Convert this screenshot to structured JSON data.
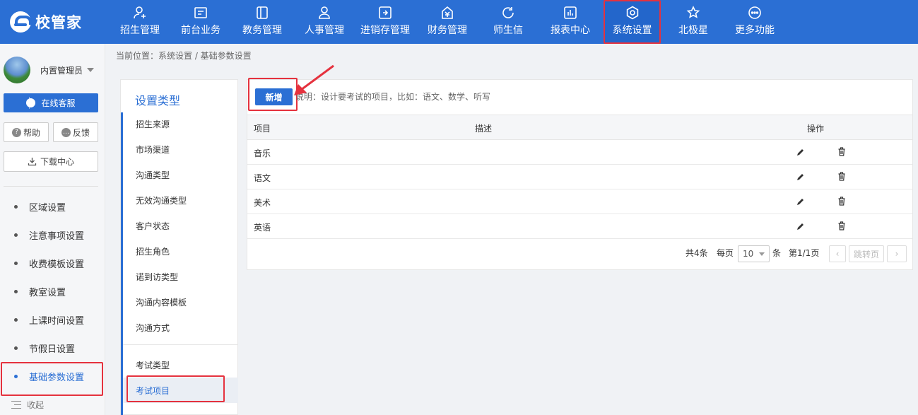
{
  "app": {
    "logo_text": "校管家"
  },
  "nav": {
    "items": [
      {
        "label": "招生管理",
        "icon": "user-add-icon"
      },
      {
        "label": "前台业务",
        "icon": "desk-icon"
      },
      {
        "label": "教务管理",
        "icon": "book-icon"
      },
      {
        "label": "人事管理",
        "icon": "person-icon"
      },
      {
        "label": "进销存管理",
        "icon": "inventory-icon"
      },
      {
        "label": "财务管理",
        "icon": "finance-icon"
      },
      {
        "label": "师生信",
        "icon": "message-icon"
      },
      {
        "label": "报表中心",
        "icon": "chart-icon"
      },
      {
        "label": "系统设置",
        "icon": "gear-icon",
        "active": true
      },
      {
        "label": "北极星",
        "icon": "star-icon"
      },
      {
        "label": "更多功能",
        "icon": "more-icon"
      }
    ]
  },
  "sidebar": {
    "username": "内置管理员",
    "service_label": "在线客服",
    "help_label": "帮助",
    "feedback_label": "反馈",
    "download_label": "下载中心",
    "menu": [
      {
        "label": "区域设置"
      },
      {
        "label": "注意事项设置"
      },
      {
        "label": "收费模板设置"
      },
      {
        "label": "教室设置"
      },
      {
        "label": "上课时间设置"
      },
      {
        "label": "节假日设置"
      },
      {
        "label": "基础参数设置",
        "active": true
      }
    ],
    "collapse_label": "收起"
  },
  "breadcrumb": "当前位置：系统设置 / 基础参数设置",
  "type_panel": {
    "title": "设置类型",
    "items": [
      "招生来源",
      "市场渠道",
      "沟通类型",
      "无效沟通类型",
      "客户状态",
      "招生角色",
      "诺到访类型",
      "沟通内容模板",
      "沟通方式"
    ],
    "items2": [
      "考试类型",
      "考试项目"
    ],
    "active": "考试项目"
  },
  "content": {
    "add_button": "新增",
    "hint": "说明：设计要考试的项目，比如：语文、数学、听写",
    "columns": {
      "item": "项目",
      "desc": "描述",
      "ops": "操作"
    },
    "rows": [
      {
        "item": "音乐",
        "desc": ""
      },
      {
        "item": "语文",
        "desc": ""
      },
      {
        "item": "美术",
        "desc": ""
      },
      {
        "item": "英语",
        "desc": ""
      }
    ],
    "pager": {
      "total": "共4条",
      "per_page_label": "每页",
      "page_size": "10",
      "unit": "条",
      "page_info": "第1/1页",
      "prev": "‹",
      "jump": "跳转页",
      "next": "›"
    }
  },
  "colors": {
    "primary": "#2b6fd4",
    "highlight": "#e5323e"
  }
}
